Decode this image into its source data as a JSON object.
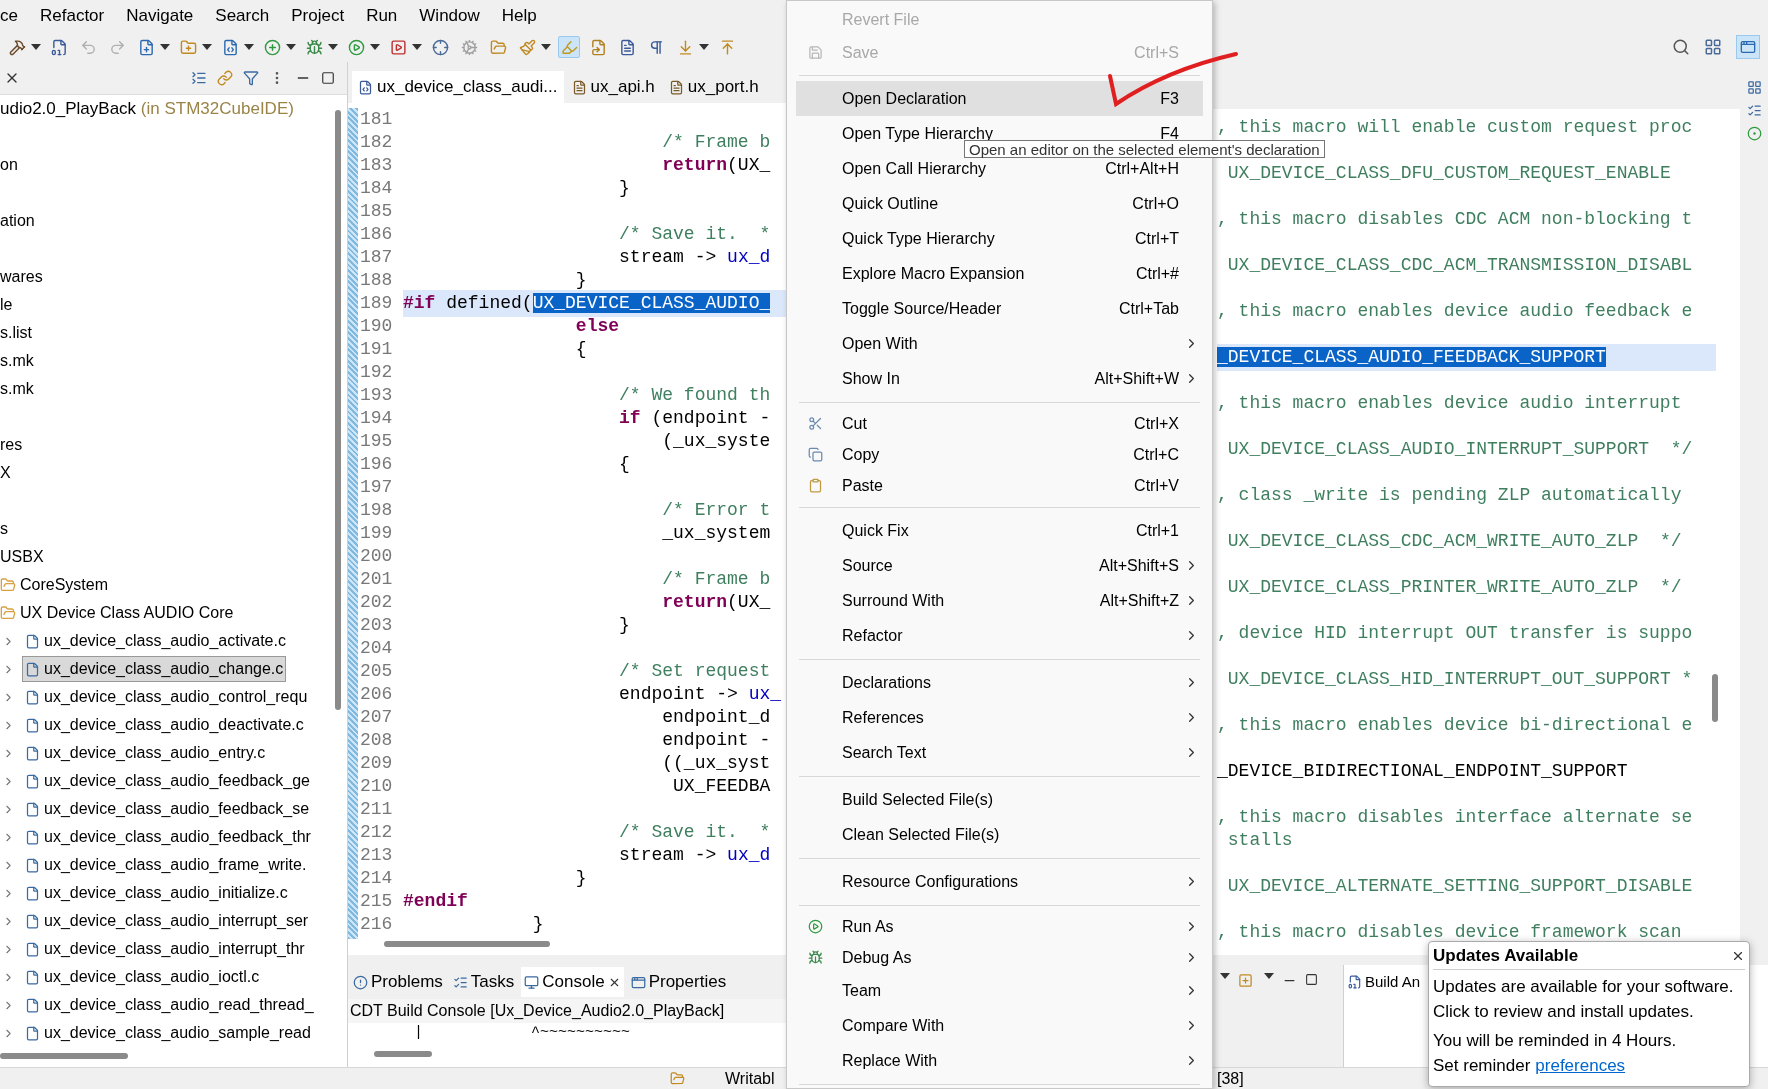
{
  "menu_bar": [
    "ce",
    "Refactor",
    "Navigate",
    "Search",
    "Project",
    "Run",
    "Window",
    "Help"
  ],
  "toolbar": [
    {
      "dropdown": true,
      "pressed": false
    },
    {
      "dropdown": false,
      "pressed": false
    },
    {
      "dropdown": false,
      "pressed": false
    },
    {
      "dropdown": false,
      "pressed": false
    },
    {
      "dropdown": true,
      "pressed": false
    },
    {
      "dropdown": true,
      "pressed": false
    },
    {
      "dropdown": true,
      "pressed": false
    },
    {
      "dropdown": true,
      "pressed": false
    },
    {
      "dropdown": true,
      "pressed": false
    },
    {
      "dropdown": true,
      "pressed": false
    },
    {
      "dropdown": true,
      "pressed": false
    },
    {
      "dropdown": false,
      "pressed": false
    },
    {
      "dropdown": false,
      "pressed": false
    },
    {
      "dropdown": false,
      "pressed": false
    },
    {
      "dropdown": true,
      "pressed": false
    },
    {
      "dropdown": false,
      "pressed": true
    },
    {
      "dropdown": false,
      "pressed": false
    },
    {
      "dropdown": false,
      "pressed": false
    },
    {
      "dropdown": false,
      "pressed": false
    },
    {
      "dropdown": true,
      "pressed": false
    },
    {
      "dropdown": false,
      "pressed": false
    }
  ],
  "project_explorer": {
    "project": {
      "name": "udio2.0_PlayBack",
      "origin": "(in STM32CubeIDE)"
    },
    "items": [
      "on",
      "ation",
      "wares",
      "le",
      "s.list",
      "s.mk",
      "s.mk",
      "res",
      "X",
      "s",
      "USBX"
    ],
    "folders": [
      {
        "name": "CoreSystem",
        "expanded": true
      },
      {
        "name": "UX Device Class AUDIO Core",
        "expanded": true,
        "children": [
          {
            "name": "ux_device_class_audio_activate.c",
            "selected": false
          },
          {
            "name": "ux_device_class_audio_change.c",
            "selected": true
          },
          {
            "name": "ux_device_class_audio_control_requ",
            "selected": false
          },
          {
            "name": "ux_device_class_audio_deactivate.c",
            "selected": false
          },
          {
            "name": "ux_device_class_audio_entry.c",
            "selected": false
          },
          {
            "name": "ux_device_class_audio_feedback_ge",
            "selected": false
          },
          {
            "name": "ux_device_class_audio_feedback_se",
            "selected": false
          },
          {
            "name": "ux_device_class_audio_feedback_thr",
            "selected": false
          },
          {
            "name": "ux_device_class_audio_frame_write.",
            "selected": false
          },
          {
            "name": "ux_device_class_audio_initialize.c",
            "selected": false
          },
          {
            "name": "ux_device_class_audio_interrupt_ser",
            "selected": false
          },
          {
            "name": "ux_device_class_audio_interrupt_thr",
            "selected": false
          },
          {
            "name": "ux_device_class_audio_ioctl.c",
            "selected": false
          },
          {
            "name": "ux_device_class_audio_read_thread_",
            "selected": false
          },
          {
            "name": "ux_device_class_audio_sample_read",
            "selected": false
          }
        ]
      }
    ]
  },
  "editor_tabs": [
    {
      "label": "ux_device_class_audi...",
      "kind": "c",
      "selected": true
    },
    {
      "label": "ux_api.h",
      "kind": "h",
      "selected": false
    },
    {
      "label": "ux_port.h",
      "kind": "h",
      "selected": false
    }
  ],
  "editor": {
    "lines": [
      {
        "number": "181"
      },
      {
        "number": "182",
        "current": false,
        "segments": [
          {
            "text": "                        /* Frame b",
            "kind": "comment"
          }
        ]
      },
      {
        "number": "183",
        "current": false,
        "segments": [
          {
            "text": "                        return",
            "kind": "keyword"
          },
          {
            "text": "(UX_",
            "kind": "plain"
          }
        ]
      },
      {
        "number": "184",
        "current": false,
        "segments": [
          {
            "text": "                    }",
            "kind": "plain"
          }
        ]
      },
      {
        "number": "185"
      },
      {
        "number": "186",
        "current": false,
        "segments": [
          {
            "text": "                    /* Save it.  *",
            "kind": "comment"
          }
        ]
      },
      {
        "number": "187",
        "current": false,
        "segments": [
          {
            "text": "                    stream -> ",
            "kind": "plain"
          },
          {
            "text": "ux_d",
            "kind": "field"
          }
        ]
      },
      {
        "number": "188",
        "current": false,
        "segments": [
          {
            "text": "                }",
            "kind": "plain"
          }
        ]
      },
      {
        "number": "189",
        "current": true,
        "segments": [
          {
            "text": "#if",
            "kind": "keyword"
          },
          {
            "text": " defined(",
            "kind": "plain"
          },
          {
            "text": "UX_DEVICE_CLASS_AUDIO_",
            "kind": "selected"
          }
        ]
      },
      {
        "number": "190",
        "current": false,
        "segments": [
          {
            "text": "                else",
            "kind": "keyword"
          }
        ]
      },
      {
        "number": "191",
        "current": false,
        "segments": [
          {
            "text": "                {",
            "kind": "plain"
          }
        ]
      },
      {
        "number": "192"
      },
      {
        "number": "193",
        "current": false,
        "segments": [
          {
            "text": "                    /* We found th",
            "kind": "comment"
          }
        ]
      },
      {
        "number": "194",
        "current": false,
        "segments": [
          {
            "text": "                    if",
            "kind": "keyword"
          },
          {
            "text": " (endpoint -",
            "kind": "plain"
          }
        ]
      },
      {
        "number": "195",
        "current": false,
        "segments": [
          {
            "text": "                        (_ux_syste",
            "kind": "plain"
          }
        ]
      },
      {
        "number": "196",
        "current": false,
        "segments": [
          {
            "text": "                    {",
            "kind": "plain"
          }
        ]
      },
      {
        "number": "197"
      },
      {
        "number": "198",
        "current": false,
        "segments": [
          {
            "text": "                        /* Error t",
            "kind": "comment"
          }
        ]
      },
      {
        "number": "199",
        "current": false,
        "segments": [
          {
            "text": "                        _ux_system",
            "kind": "plain"
          }
        ]
      },
      {
        "number": "200"
      },
      {
        "number": "201",
        "current": false,
        "segments": [
          {
            "text": "                        /* Frame b",
            "kind": "comment"
          }
        ]
      },
      {
        "number": "202",
        "current": false,
        "segments": [
          {
            "text": "                        return",
            "kind": "keyword"
          },
          {
            "text": "(UX_",
            "kind": "plain"
          }
        ]
      },
      {
        "number": "203",
        "current": false,
        "segments": [
          {
            "text": "                    }",
            "kind": "plain"
          }
        ]
      },
      {
        "number": "204"
      },
      {
        "number": "205",
        "current": false,
        "segments": [
          {
            "text": "                    /* Set request",
            "kind": "comment"
          }
        ]
      },
      {
        "number": "206",
        "current": false,
        "segments": [
          {
            "text": "                    endpoint -> ",
            "kind": "plain"
          },
          {
            "text": "ux_",
            "kind": "field"
          }
        ]
      },
      {
        "number": "207",
        "current": false,
        "segments": [
          {
            "text": "                        endpoint_d",
            "kind": "plain"
          }
        ]
      },
      {
        "number": "208",
        "current": false,
        "segments": [
          {
            "text": "                        endpoint -",
            "kind": "plain"
          }
        ]
      },
      {
        "number": "209",
        "current": false,
        "segments": [
          {
            "text": "                        ((_ux_syst",
            "kind": "plain"
          }
        ]
      },
      {
        "number": "210",
        "current": false,
        "segments": [
          {
            "text": "                         UX_FEEDBA",
            "kind": "plain"
          }
        ]
      },
      {
        "number": "211"
      },
      {
        "number": "212",
        "current": false,
        "segments": [
          {
            "text": "                    /* Save it.  *",
            "kind": "comment"
          }
        ]
      },
      {
        "number": "213",
        "current": false,
        "segments": [
          {
            "text": "                    stream -> ",
            "kind": "plain"
          },
          {
            "text": "ux_d",
            "kind": "field"
          }
        ]
      },
      {
        "number": "214",
        "current": false,
        "segments": [
          {
            "text": "                }",
            "kind": "plain"
          }
        ]
      },
      {
        "number": "215",
        "current": false,
        "segments": [
          {
            "text": "#endif",
            "kind": "keyword"
          }
        ]
      },
      {
        "number": "216",
        "current": false,
        "segments": [
          {
            "text": "            }",
            "kind": "plain"
          }
        ]
      }
    ]
  },
  "second_editor": {
    "blocks": [
      {
        "current": false,
        "lines": [
          [
            {
              "text": ", this macro will enable custom request proc",
              "kind": "comment"
            }
          ]
        ]
      },
      {
        "current": false,
        "lines": [
          [
            {
              "text": " UX_DEVICE_CLASS_DFU_CUSTOM_REQUEST_ENABLE",
              "kind": "comment"
            }
          ]
        ]
      },
      {
        "current": false,
        "lines": [
          [
            {
              "text": ", this macro disables CDC ACM non-blocking t",
              "kind": "comment"
            }
          ]
        ]
      },
      {
        "current": false,
        "lines": [
          [
            {
              "text": " UX_DEVICE_CLASS_CDC_ACM_TRANSMISSION_DISABL",
              "kind": "comment"
            }
          ]
        ]
      },
      {
        "current": false,
        "lines": [
          [
            {
              "text": ", this macro enables device audio feedback e",
              "kind": "comment"
            }
          ]
        ]
      },
      {
        "current": true,
        "lines": [
          [
            {
              "text": "_DEVICE_CLASS_AUDIO_FEEDBACK_SUPPORT",
              "kind": "selected"
            }
          ]
        ]
      },
      {
        "current": false,
        "lines": [
          [
            {
              "text": ", this macro enables device audio interrupt",
              "kind": "comment"
            }
          ]
        ]
      },
      {
        "current": false,
        "lines": [
          [
            {
              "text": " UX_DEVICE_CLASS_AUDIO_INTERRUPT_SUPPORT  */",
              "kind": "comment"
            }
          ]
        ]
      },
      {
        "current": false,
        "lines": [
          [
            {
              "text": ", class _write is pending ZLP automatically",
              "kind": "comment"
            }
          ]
        ]
      },
      {
        "current": false,
        "lines": [
          [
            {
              "text": " UX_DEVICE_CLASS_CDC_ACM_WRITE_AUTO_ZLP  */",
              "kind": "comment"
            }
          ]
        ]
      },
      {
        "current": false,
        "lines": [
          [
            {
              "text": " UX_DEVICE_CLASS_PRINTER_WRITE_AUTO_ZLP  */",
              "kind": "comment"
            }
          ]
        ]
      },
      {
        "current": false,
        "lines": [
          [
            {
              "text": ", device HID interrupt OUT transfer is suppo",
              "kind": "comment"
            }
          ]
        ]
      },
      {
        "current": false,
        "lines": [
          [
            {
              "text": " UX_DEVICE_CLASS_HID_INTERRUPT_OUT_SUPPORT *",
              "kind": "comment"
            }
          ]
        ]
      },
      {
        "current": false,
        "lines": [
          [
            {
              "text": ", this macro enables device bi-directional e",
              "kind": "comment"
            }
          ]
        ]
      },
      {
        "current": false,
        "lines": [
          [
            {
              "text": "_DEVICE_BIDIRECTIONAL_ENDPOINT_SUPPORT",
              "kind": "plain"
            }
          ]
        ]
      },
      {
        "current": false,
        "lines": [
          [
            {
              "text": ", this macro disables interface alternate se",
              "kind": "comment"
            }
          ],
          [
            {
              "text": " stalls",
              "kind": "comment"
            }
          ]
        ]
      },
      {
        "current": false,
        "lines": [
          [
            {
              "text": " UX_DEVICE_ALTERNATE_SETTING_SUPPORT_DISABLE",
              "kind": "comment"
            }
          ]
        ]
      },
      {
        "current": false,
        "lines": [
          [
            {
              "text": ", this macro disables device framework scan",
              "kind": "comment"
            }
          ]
        ]
      }
    ]
  },
  "context_menu": [
    {
      "kind": "item",
      "label": "Revert File",
      "disabled": true,
      "selected": false,
      "submenu": false
    },
    {
      "kind": "item",
      "label": "Save",
      "shortcut": "Ctrl+S",
      "disabled": true,
      "selected": false,
      "submenu": false
    },
    {
      "kind": "separator"
    },
    {
      "kind": "item",
      "label": "Open Declaration",
      "shortcut": "F3",
      "disabled": false,
      "selected": true,
      "submenu": false
    },
    {
      "kind": "item",
      "label": "Open Type Hierarchy",
      "shortcut": "F4",
      "disabled": false,
      "selected": false,
      "submenu": false
    },
    {
      "kind": "item",
      "label": "Open Call Hierarchy",
      "shortcut": "Ctrl+Alt+H",
      "disabled": false,
      "selected": false,
      "submenu": false
    },
    {
      "kind": "item",
      "label": "Quick Outline",
      "shortcut": "Ctrl+O",
      "disabled": false,
      "selected": false,
      "submenu": false
    },
    {
      "kind": "item",
      "label": "Quick Type Hierarchy",
      "shortcut": "Ctrl+T",
      "disabled": false,
      "selected": false,
      "submenu": false
    },
    {
      "kind": "item",
      "label": "Explore Macro Expansion",
      "shortcut": "Ctrl+#",
      "disabled": false,
      "selected": false,
      "submenu": false
    },
    {
      "kind": "item",
      "label": "Toggle Source/Header",
      "shortcut": "Ctrl+Tab",
      "disabled": false,
      "selected": false,
      "submenu": false
    },
    {
      "kind": "item",
      "label": "Open With",
      "disabled": false,
      "selected": false,
      "submenu": true
    },
    {
      "kind": "item",
      "label": "Show In",
      "shortcut": "Alt+Shift+W",
      "disabled": false,
      "selected": false,
      "submenu": true
    },
    {
      "kind": "separator"
    },
    {
      "kind": "item",
      "label": "Cut",
      "shortcut": "Ctrl+X",
      "disabled": false,
      "selected": false,
      "submenu": false
    },
    {
      "kind": "item",
      "label": "Copy",
      "shortcut": "Ctrl+C",
      "disabled": false,
      "selected": false,
      "submenu": false
    },
    {
      "kind": "item",
      "label": "Paste",
      "shortcut": "Ctrl+V",
      "disabled": false,
      "selected": false,
      "submenu": false
    },
    {
      "kind": "separator"
    },
    {
      "kind": "item",
      "label": "Quick Fix",
      "shortcut": "Ctrl+1",
      "disabled": false,
      "selected": false,
      "submenu": false
    },
    {
      "kind": "item",
      "label": "Source",
      "shortcut": "Alt+Shift+S",
      "disabled": false,
      "selected": false,
      "submenu": true
    },
    {
      "kind": "item",
      "label": "Surround With",
      "shortcut": "Alt+Shift+Z",
      "disabled": false,
      "selected": false,
      "submenu": true
    },
    {
      "kind": "item",
      "label": "Refactor",
      "disabled": false,
      "selected": false,
      "submenu": true
    },
    {
      "kind": "separator"
    },
    {
      "kind": "item",
      "label": "Declarations",
      "disabled": false,
      "selected": false,
      "submenu": true
    },
    {
      "kind": "item",
      "label": "References",
      "disabled": false,
      "selected": false,
      "submenu": true
    },
    {
      "kind": "item",
      "label": "Search Text",
      "disabled": false,
      "selected": false,
      "submenu": true
    },
    {
      "kind": "separator"
    },
    {
      "kind": "item",
      "label": "Build Selected File(s)",
      "disabled": false,
      "selected": false,
      "submenu": false
    },
    {
      "kind": "item",
      "label": "Clean Selected File(s)",
      "disabled": false,
      "selected": false,
      "submenu": false
    },
    {
      "kind": "separator"
    },
    {
      "kind": "item",
      "label": "Resource Configurations",
      "disabled": false,
      "selected": false,
      "submenu": true
    },
    {
      "kind": "separator"
    },
    {
      "kind": "item",
      "label": "Run As",
      "disabled": false,
      "selected": false,
      "submenu": true
    },
    {
      "kind": "item",
      "label": "Debug As",
      "disabled": false,
      "selected": false,
      "submenu": true
    },
    {
      "kind": "item",
      "label": "Team",
      "disabled": false,
      "selected": false,
      "submenu": true
    },
    {
      "kind": "item",
      "label": "Compare With",
      "disabled": false,
      "selected": false,
      "submenu": true
    },
    {
      "kind": "item",
      "label": "Replace With",
      "disabled": false,
      "selected": false,
      "submenu": true
    },
    {
      "kind": "separator"
    }
  ],
  "tooltip": {
    "text": "Open an editor on the selected element's declaration"
  },
  "bottom_panel": {
    "tabs": [
      {
        "label": "Problems",
        "selected": false
      },
      {
        "label": "Tasks",
        "selected": false
      },
      {
        "label": "Console",
        "selected": true
      },
      {
        "label": "Properties",
        "selected": false
      }
    ],
    "console_title": "CDT Build Console [Ux_Device_Audio2.0_PlayBack]",
    "console_line": "|            ^~~~~~~~~~~"
  },
  "side_panel_tab": {
    "label": "Build An"
  },
  "status_bar": {
    "field_1": "Writabl",
    "field_2": "[38]"
  },
  "notification": {
    "title": "Updates Available",
    "lines": [
      "Updates are available for your software.",
      "Click to review and install updates."
    ],
    "reminder": "You will be reminded in 4 Hours.",
    "setting": "Set reminder",
    "link": "preferences"
  }
}
